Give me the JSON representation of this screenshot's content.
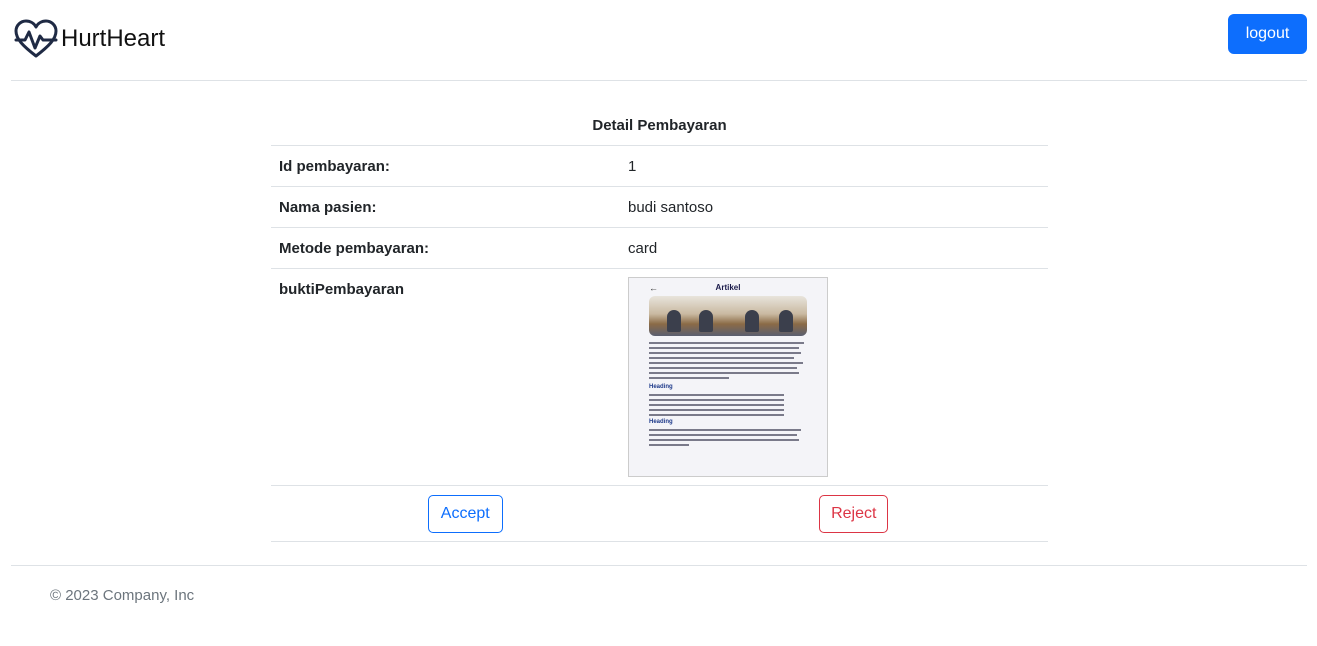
{
  "header": {
    "brand_name": "HurtHeart",
    "brand_icon": "heart-pulse-icon",
    "logout_label": "logout",
    "accent": "#0d6efd"
  },
  "detail": {
    "title": "Detail Pembayaran",
    "rows": [
      {
        "label": "Id pembayaran:",
        "value": "1"
      },
      {
        "label": "Nama pasien:",
        "value": "budi santoso"
      },
      {
        "label": "Metode pembayaran:",
        "value": "card"
      }
    ],
    "proof_label": "buktiPembayaran",
    "proof_image": {
      "title": "Artikel",
      "back_glyph": "←",
      "heading_1": "Heading",
      "heading_2": "Heading"
    }
  },
  "actions": {
    "accept_label": "Accept",
    "reject_label": "Reject",
    "accept_color": "#0d6efd",
    "reject_color": "#dc3545"
  },
  "footer": {
    "text": "© 2023 Company, Inc"
  }
}
